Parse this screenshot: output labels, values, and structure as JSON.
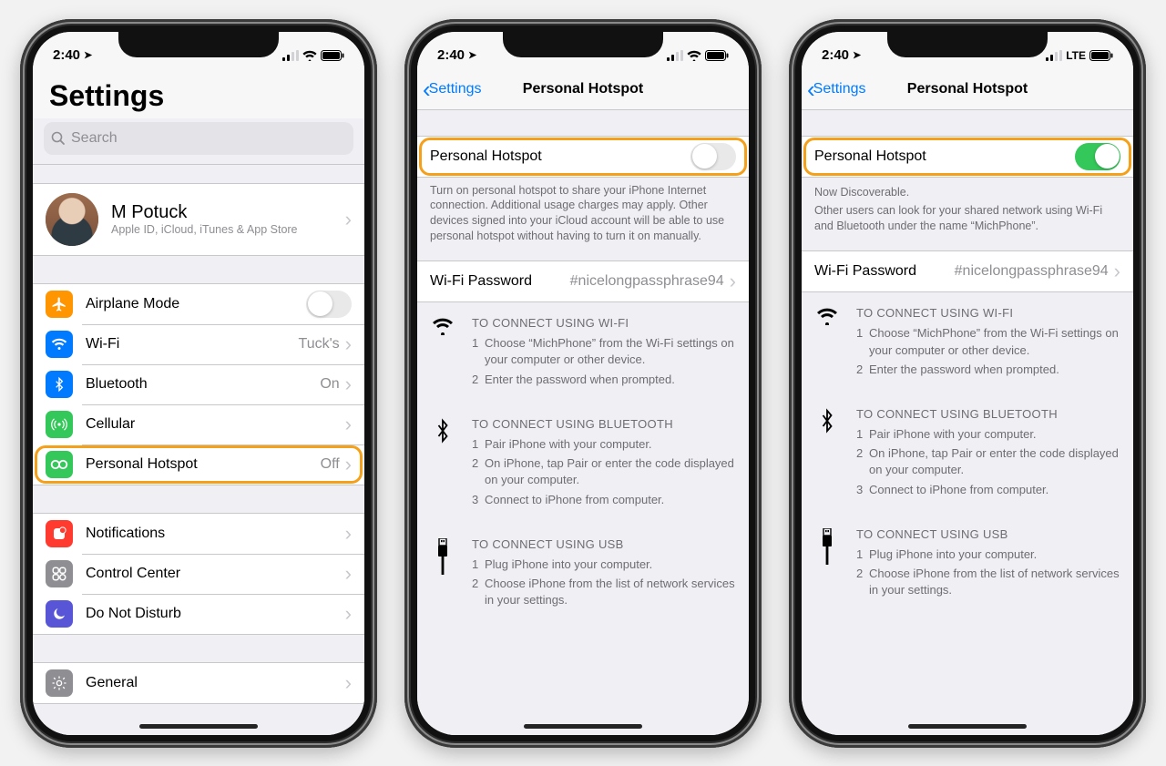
{
  "status": {
    "time": "2:40",
    "lte": "LTE"
  },
  "phone1": {
    "title": "Settings",
    "search_placeholder": "Search",
    "profile": {
      "name": "M Potuck",
      "sub": "Apple ID, iCloud, iTunes & App Store"
    },
    "rows1": {
      "airplane": "Airplane Mode",
      "wifi": {
        "label": "Wi-Fi",
        "value": "Tuck's"
      },
      "bluetooth": {
        "label": "Bluetooth",
        "value": "On"
      },
      "cellular": "Cellular",
      "hotspot": {
        "label": "Personal Hotspot",
        "value": "Off"
      }
    },
    "rows2": {
      "notifications": "Notifications",
      "control_center": "Control Center",
      "dnd": "Do Not Disturb"
    },
    "rows3": {
      "general": "General"
    }
  },
  "phone2": {
    "back": "Settings",
    "title": "Personal Hotspot",
    "toggle_label": "Personal Hotspot",
    "toggle_on": false,
    "footer": "Turn on personal hotspot to share your iPhone Internet connection. Additional usage charges may apply. Other devices signed into your iCloud account will be able to use personal hotspot without having to turn it on manually.",
    "wifi_pw": {
      "label": "Wi-Fi Password",
      "value": "#nicelongpassphrase94"
    },
    "instr": {
      "wifi": {
        "head": "TO CONNECT USING WI-FI",
        "steps": [
          "Choose “MichPhone” from the Wi-Fi settings on your computer or other device.",
          "Enter the password when prompted."
        ]
      },
      "bt": {
        "head": "TO CONNECT USING BLUETOOTH",
        "steps": [
          "Pair iPhone with your computer.",
          "On iPhone, tap Pair or enter the code displayed on your computer.",
          "Connect to iPhone from computer."
        ]
      },
      "usb": {
        "head": "TO CONNECT USING USB",
        "steps": [
          "Plug iPhone into your computer.",
          "Choose iPhone from the list of network services in your settings."
        ]
      }
    }
  },
  "phone3": {
    "back": "Settings",
    "title": "Personal Hotspot",
    "toggle_label": "Personal Hotspot",
    "toggle_on": true,
    "discoverable": "Now Discoverable.",
    "subfooter": "Other users can look for your shared network using Wi-Fi and Bluetooth under the name “MichPhone”.",
    "wifi_pw": {
      "label": "Wi-Fi Password",
      "value": "#nicelongpassphrase94"
    },
    "instr": {
      "wifi": {
        "head": "TO CONNECT USING WI-FI",
        "steps": [
          "Choose “MichPhone” from the Wi-Fi settings on your computer or other device.",
          "Enter the password when prompted."
        ]
      },
      "bt": {
        "head": "TO CONNECT USING BLUETOOTH",
        "steps": [
          "Pair iPhone with your computer.",
          "On iPhone, tap Pair or enter the code displayed on your computer.",
          "Connect to iPhone from computer."
        ]
      },
      "usb": {
        "head": "TO CONNECT USING USB",
        "steps": [
          "Plug iPhone into your computer.",
          "Choose iPhone from the list of network services in your settings."
        ]
      }
    }
  }
}
